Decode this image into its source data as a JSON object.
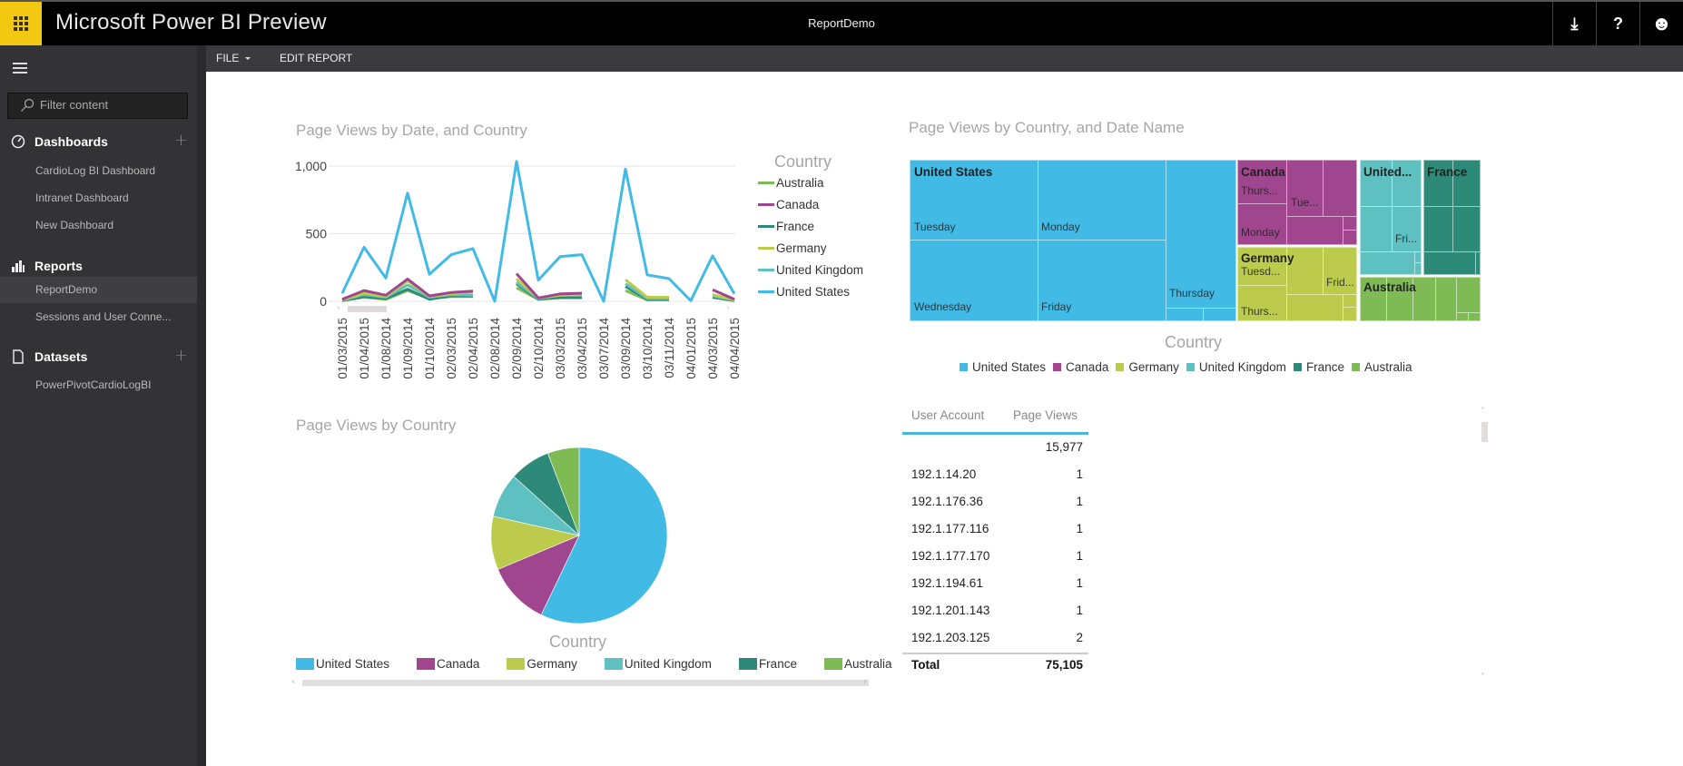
{
  "header": {
    "app_title": "Microsoft Power BI Preview",
    "doc_title": "ReportDemo",
    "icons": [
      "download-icon",
      "help-icon",
      "feedback-smiley-icon"
    ],
    "icon_glyphs": {
      "download": "⤓",
      "help": "?",
      "smile": "☻"
    }
  },
  "toolbar": {
    "file_label": "FILE",
    "edit_report_label": "EDIT REPORT"
  },
  "sidebar": {
    "search_placeholder": "Filter content",
    "sections": [
      {
        "label": "Dashboards",
        "icon": "gauge-icon",
        "has_add": true,
        "items": [
          "CardioLog BI Dashboard",
          "Intranet Dashboard",
          "New Dashboard"
        ]
      },
      {
        "label": "Reports",
        "icon": "bar-chart-icon",
        "has_add": false,
        "items": [
          "ReportDemo",
          "Sessions and User Conne..."
        ],
        "active_item": "ReportDemo"
      },
      {
        "label": "Datasets",
        "icon": "document-icon",
        "has_add": true,
        "items": [
          "PowerPivotCardioLogBI"
        ]
      }
    ],
    "add_glyph": "+"
  },
  "colors": {
    "United States": "#41bbe6",
    "Canada": "#a0468f",
    "Germany": "#bccb4b",
    "United Kingdom": "#5ec0c0",
    "France": "#2e8a78",
    "Australia": "#7fbb55",
    "accent": "#f2c811"
  },
  "line_legend_order": [
    "Australia",
    "Canada",
    "France",
    "Germany",
    "United Kingdom",
    "United States"
  ],
  "pie_legend_order": [
    "United States",
    "Canada",
    "Germany",
    "United Kingdom",
    "France",
    "Australia"
  ],
  "treemap_legend_order": [
    "United States",
    "Canada",
    "Germany",
    "United Kingdom",
    "France",
    "Australia"
  ],
  "chart_data": [
    {
      "type": "line",
      "title": "Page Views by Date, and Country",
      "xlabel": "",
      "ylabel": "",
      "legend_title": "Country",
      "legend_position": "right",
      "ylim": [
        0,
        1050
      ],
      "yticks": [
        0,
        500,
        1000
      ],
      "ytick_labels": [
        "0",
        "500",
        "1,000"
      ],
      "grid": true,
      "categories": [
        "01/03/2015",
        "01/04/2015",
        "01/08/2014",
        "01/09/2014",
        "01/10/2014",
        "02/03/2015",
        "02/04/2015",
        "02/08/2014",
        "02/09/2014",
        "02/10/2014",
        "03/03/2015",
        "03/04/2015",
        "03/07/2014",
        "03/09/2014",
        "03/10/2014",
        "03/11/2014",
        "04/01/2015",
        "04/03/2015",
        "04/04/2015"
      ],
      "series": [
        {
          "name": "United States",
          "values": [
            60,
            400,
            172,
            800,
            200,
            345,
            390,
            0,
            1035,
            157,
            330,
            345,
            0,
            978,
            195,
            168,
            5,
            336,
            56
          ]
        },
        {
          "name": "Canada",
          "values": [
            15,
            80,
            45,
            165,
            40,
            65,
            75,
            null,
            205,
            25,
            55,
            60,
            null,
            null,
            null,
            null,
            null,
            85,
            15
          ]
        },
        {
          "name": "Germany",
          "values": [
            10,
            60,
            35,
            150,
            35,
            55,
            70,
            null,
            165,
            25,
            45,
            50,
            null,
            160,
            30,
            30,
            null,
            50,
            10
          ]
        },
        {
          "name": "United Kingdom",
          "values": [
            8,
            50,
            30,
            120,
            30,
            50,
            45,
            null,
            140,
            20,
            45,
            45,
            null,
            130,
            20,
            20,
            null,
            40,
            8
          ]
        },
        {
          "name": "France",
          "values": [
            5,
            35,
            20,
            90,
            15,
            40,
            40,
            null,
            130,
            15,
            30,
            30,
            null,
            110,
            15,
            15,
            null,
            30,
            5
          ]
        },
        {
          "name": "Australia",
          "values": [
            5,
            30,
            15,
            80,
            20,
            35,
            35,
            null,
            100,
            15,
            25,
            25,
            null,
            80,
            10,
            10,
            null,
            30,
            5
          ]
        }
      ]
    },
    {
      "type": "pie",
      "title": "Page Views by Country",
      "legend_title": "Country",
      "legend_position": "bottom",
      "categories": [
        "United States",
        "Canada",
        "Germany",
        "United Kingdom",
        "France",
        "Australia"
      ],
      "values": [
        57.1,
        11.6,
        9.8,
        8.2,
        7.5,
        5.8
      ],
      "value_unit": "percent of page views (estimated)"
    },
    {
      "type": "treemap",
      "title": "Page Views by Country, and Date Name",
      "legend_title": "Country",
      "legend_position": "bottom",
      "groups": [
        {
          "name": "United States",
          "share": 0.57,
          "cells": [
            {
              "label": "Tuesday",
              "share": 0.165
            },
            {
              "label": "Monday",
              "share": 0.165
            },
            {
              "label": "Wednesday",
              "share": 0.165
            },
            {
              "label": "Friday",
              "share": 0.165
            },
            {
              "label": "Thursday",
              "share": 0.12
            },
            {
              "label": "",
              "share": 0.01
            },
            {
              "label": "",
              "share": 0.01
            }
          ]
        },
        {
          "name": "Canada",
          "share": 0.12,
          "cells": [
            {
              "label": "Thurs..."
            },
            {
              "label": "Tue..."
            },
            {
              "label": "Monday"
            }
          ]
        },
        {
          "name": "Germany",
          "share": 0.1,
          "cells": [
            {
              "label": "Tuesd..."
            },
            {
              "label": "Frid..."
            },
            {
              "label": "Thurs..."
            }
          ]
        },
        {
          "name": "United...",
          "full_name": "United Kingdom",
          "share": 0.08,
          "cells": [
            {
              "label": "Fri..."
            }
          ]
        },
        {
          "name": "France",
          "share": 0.075,
          "cells": []
        },
        {
          "name": "Australia",
          "share": 0.06,
          "cells": []
        }
      ]
    },
    {
      "type": "table",
      "columns": [
        "User Account",
        "Page Views"
      ],
      "rows": [
        [
          "",
          "15,977"
        ],
        [
          "192.1.14.20",
          "1"
        ],
        [
          "192.1.176.36",
          "1"
        ],
        [
          "192.1.177.116",
          "1"
        ],
        [
          "192.1.177.170",
          "1"
        ],
        [
          "192.1.194.61",
          "1"
        ],
        [
          "192.1.201.143",
          "1"
        ],
        [
          "192.1.203.125",
          "2"
        ]
      ],
      "total_label": "Total",
      "total_value": "75,105"
    }
  ]
}
